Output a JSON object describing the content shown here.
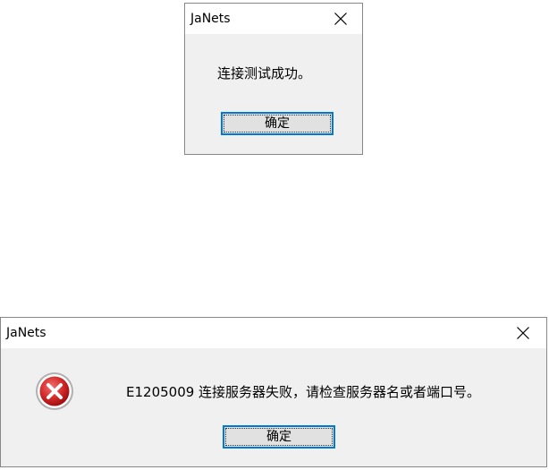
{
  "dialog_success": {
    "title": "JaNets",
    "message": "连接测试成功。",
    "ok_label": "确定",
    "close_icon": "close-icon"
  },
  "dialog_error": {
    "title": "JaNets",
    "message": "E1205009 连接服务器失败，请检查服务器名或者端口号。",
    "ok_label": "确定",
    "close_icon": "close-icon",
    "status_icon": "error-icon",
    "status_color": "#d42a2a"
  },
  "colors": {
    "focus_border": "#0078d7",
    "button_face": "#e1e1e1",
    "dialog_face": "#f0f0f0"
  }
}
